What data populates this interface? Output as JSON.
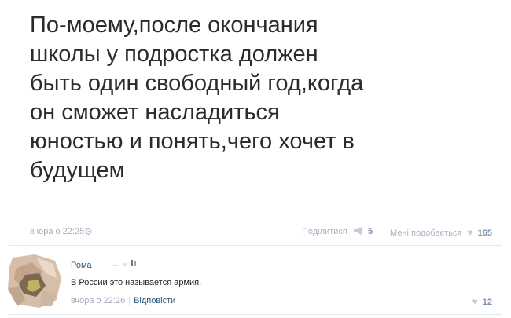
{
  "post": {
    "text": "По-моему,после окончания\nшколы у подростка должен\nбыть один свободный год,когда\nон сможет насладиться\nюностью и понять,чего хочет в\nбудущем",
    "time": "вчора о 22:25",
    "share_label": "Поділитися",
    "share_count": "5",
    "likes_label": "Мені подобається",
    "likes_count": "165"
  },
  "comment": {
    "author": "Рома",
    "text": "В России это называется армия.",
    "time": "вчора о 22:26",
    "reply_label": "Відповісти",
    "likes_count": "12"
  },
  "colors": {
    "link": "#2b587a",
    "meta": "#a6aebc",
    "count": "#7f94b2"
  },
  "icons": {
    "settings": "gear-icon",
    "share": "megaphone-icon",
    "like": "heart-icon"
  }
}
